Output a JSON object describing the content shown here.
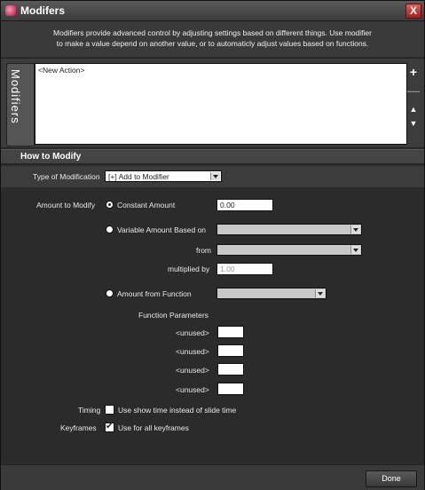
{
  "window": {
    "title": "Modifers",
    "close_label": "X"
  },
  "description": {
    "line1": "Modifiers provide advanced control by adjusting settings based on different things. Use modifier",
    "line2": "to make a value depend on another value, or to automaticly adjust values based on functions."
  },
  "modifiers": {
    "tab_label": "Modifiers",
    "items": [
      "<New Action>"
    ],
    "add_label": "+",
    "remove_label": "—",
    "up_label": "▲",
    "down_label": "▼"
  },
  "how_to_modify": {
    "header": "How to Modify",
    "type_label": "Type of Modification",
    "type_value": "[+] Add to Modifier",
    "amount_label": "Amount to Modify",
    "constant_label": "Constant Amount",
    "constant_value": "0.00",
    "variable_label": "Variable Amount Based on",
    "variable_value": "",
    "from_label": "from",
    "from_value": "",
    "multiplied_label": "multiplied by",
    "multiplied_value": "1.00",
    "function_label": "Amount from Function",
    "function_value": "",
    "params_label": "Function Parameters",
    "params": [
      {
        "label": "<unused>",
        "value": ""
      },
      {
        "label": "<unused>",
        "value": ""
      },
      {
        "label": "<unused>",
        "value": ""
      },
      {
        "label": "<unused>",
        "value": ""
      }
    ],
    "timing_label": "Timing",
    "timing_option": "Use show time instead of slide time",
    "timing_checked": false,
    "keyframes_label": "Keyframes",
    "keyframes_option": "Use for all keyframes",
    "keyframes_checked": true
  },
  "footer": {
    "done_label": "Done"
  }
}
